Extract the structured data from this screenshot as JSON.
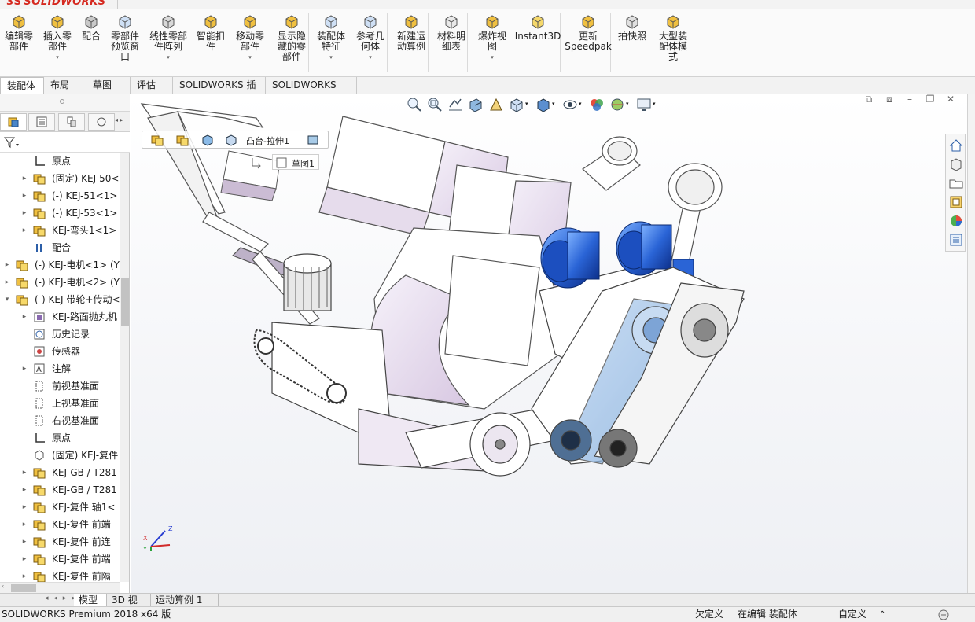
{
  "app": {
    "brand": "SOLIDWORKS",
    "accent": "#d5281f"
  },
  "ribbon": {
    "buttons": [
      {
        "label": "编辑零\n部件",
        "icon": "edit-component-icon"
      },
      {
        "label": "插入零\n部件",
        "icon": "insert-component-icon",
        "dropdown": true
      },
      {
        "label": "配合",
        "icon": "mate-icon"
      },
      {
        "label": "零部件\n预览窗\n口",
        "icon": "component-preview-icon"
      },
      {
        "label": "线性零部\n件阵列",
        "icon": "linear-pattern-icon",
        "dropdown": true
      },
      {
        "label": "智能扣\n件",
        "icon": "smart-fasteners-icon"
      },
      {
        "label": "移动零\n部件",
        "icon": "move-component-icon",
        "dropdown": true
      },
      {
        "label": "显示隐\n藏的零\n部件",
        "icon": "show-hidden-icon"
      },
      {
        "label": "装配体\n特征",
        "icon": "assembly-feature-icon",
        "dropdown": true
      },
      {
        "label": "参考几\n何体",
        "icon": "reference-geometry-icon",
        "dropdown": true
      },
      {
        "label": "新建运\n动算例",
        "icon": "motion-study-icon"
      },
      {
        "label": "材料明\n细表",
        "icon": "bill-of-materials-icon"
      },
      {
        "label": "爆炸视\n图",
        "icon": "exploded-view-icon",
        "dropdown": true
      },
      {
        "label": "Instant3D",
        "icon": "instant3d-icon"
      },
      {
        "label": "更新\nSpeedpak",
        "icon": "speedpak-icon"
      },
      {
        "label": "拍快照",
        "icon": "snapshot-icon"
      },
      {
        "label": "大型装\n配体模\n式",
        "icon": "large-assembly-icon"
      }
    ]
  },
  "command_tabs": [
    "装配体",
    "布局",
    "草图",
    "评估",
    "SOLIDWORKS 插件",
    "SOLIDWORKS MBD"
  ],
  "active_command_tab": "装配体",
  "feature_tree": [
    {
      "level": 2,
      "expand": false,
      "icon": "origin",
      "label": "原点"
    },
    {
      "level": 2,
      "expand": true,
      "icon": "part",
      "label": "(固定) KEJ-50<"
    },
    {
      "level": 2,
      "expand": true,
      "icon": "part",
      "label": "(-) KEJ-51<1>"
    },
    {
      "level": 2,
      "expand": true,
      "icon": "part",
      "label": "(-) KEJ-53<1>"
    },
    {
      "level": 2,
      "expand": true,
      "icon": "part",
      "label": "KEJ-弯头1<1>"
    },
    {
      "level": 2,
      "expand": false,
      "icon": "mate",
      "label": "配合"
    },
    {
      "level": 1,
      "expand": true,
      "icon": "assembly",
      "label": "(-) KEJ-电机<1> (Y"
    },
    {
      "level": 1,
      "expand": true,
      "icon": "assembly",
      "label": "(-) KEJ-电机<2> (Y"
    },
    {
      "level": 1,
      "expand": "open",
      "icon": "assembly",
      "label": "(-) KEJ-带轮+传动<"
    },
    {
      "level": 2,
      "expand": true,
      "icon": "asm-folder",
      "label": "KEJ-路面抛丸机"
    },
    {
      "level": 2,
      "expand": false,
      "icon": "history",
      "label": "历史记录"
    },
    {
      "level": 2,
      "expand": false,
      "icon": "sensor",
      "label": "传感器"
    },
    {
      "level": 2,
      "expand": true,
      "icon": "annotation",
      "label": "注解"
    },
    {
      "level": 2,
      "expand": false,
      "icon": "plane",
      "label": "前视基准面"
    },
    {
      "level": 2,
      "expand": false,
      "icon": "plane",
      "label": "上视基准面"
    },
    {
      "level": 2,
      "expand": false,
      "icon": "plane",
      "label": "右视基准面"
    },
    {
      "level": 2,
      "expand": false,
      "icon": "origin",
      "label": "原点"
    },
    {
      "level": 2,
      "expand": false,
      "icon": "fixed",
      "label": "(固定) KEJ-复件"
    },
    {
      "level": 2,
      "expand": true,
      "icon": "part",
      "label": "KEJ-GB / T281"
    },
    {
      "level": 2,
      "expand": true,
      "icon": "part",
      "label": "KEJ-GB / T281"
    },
    {
      "level": 2,
      "expand": true,
      "icon": "part",
      "label": "KEJ-复件 轴1<"
    },
    {
      "level": 2,
      "expand": true,
      "icon": "part",
      "label": "KEJ-复件 前端"
    },
    {
      "level": 2,
      "expand": true,
      "icon": "part",
      "label": "KEJ-复件 前连"
    },
    {
      "level": 2,
      "expand": true,
      "icon": "part",
      "label": "KEJ-复件 前端"
    },
    {
      "level": 2,
      "expand": true,
      "icon": "part",
      "label": "KEJ-复件 前隔"
    }
  ],
  "breadcrumb": {
    "feature": "凸台-拉伸1",
    "sketch": "草图1"
  },
  "bottom_tabs": [
    "模型",
    "3D 视图",
    "运动算例 1"
  ],
  "active_bottom_tab": "模型",
  "status": {
    "product": "SOLIDWORKS Premium 2018 x64 版",
    "state1": "欠定义",
    "state2": "在编辑 装配体",
    "units": "自定义"
  },
  "triad": {
    "x": "X",
    "y": "Y",
    "z": "Z"
  }
}
